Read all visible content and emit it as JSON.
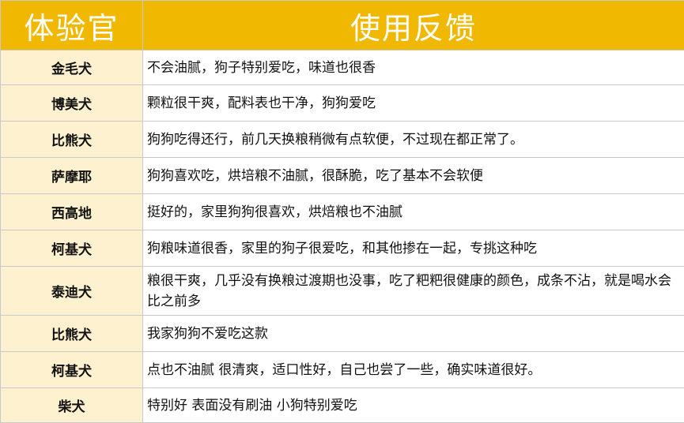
{
  "header": {
    "col_breed": "体验官",
    "col_feedback": "使用反馈"
  },
  "rows": [
    {
      "breed": "金毛犬",
      "feedback": "不会油腻，狗子特别爱吃，味道也很香"
    },
    {
      "breed": "博美犬",
      "feedback": "颗粒很干爽，配料表也干净，狗狗爱吃"
    },
    {
      "breed": "比熊犬",
      "feedback": "狗狗吃得还行，前几天换粮稍微有点软便，不过现在都正常了。"
    },
    {
      "breed": "萨摩耶",
      "feedback": "狗狗喜欢吃，烘培粮不油腻，很酥脆，吃了基本不会软便"
    },
    {
      "breed": "西高地",
      "feedback": "挺好的，家里狗狗很喜欢，烘焙粮也不油腻"
    },
    {
      "breed": "柯基犬",
      "feedback": "狗粮味道很香，家里的狗子很爱吃，和其他掺在一起，专挑这种吃"
    },
    {
      "breed": "泰迪犬",
      "feedback": "粮很干爽，几乎没有换粮过渡期也没事，吃了粑粑很健康的颜色，成条不沾，就是喝水会比之前多"
    },
    {
      "breed": "比熊犬",
      "feedback": "我家狗狗不爱吃这款"
    },
    {
      "breed": "柯基犬",
      "feedback": "点也不油腻 很清爽，适口性好，自己也尝了一些，确实味道很好。"
    },
    {
      "breed": "柴犬",
      "feedback": "特别好 表面没有刷油 小狗特别爱吃"
    }
  ]
}
